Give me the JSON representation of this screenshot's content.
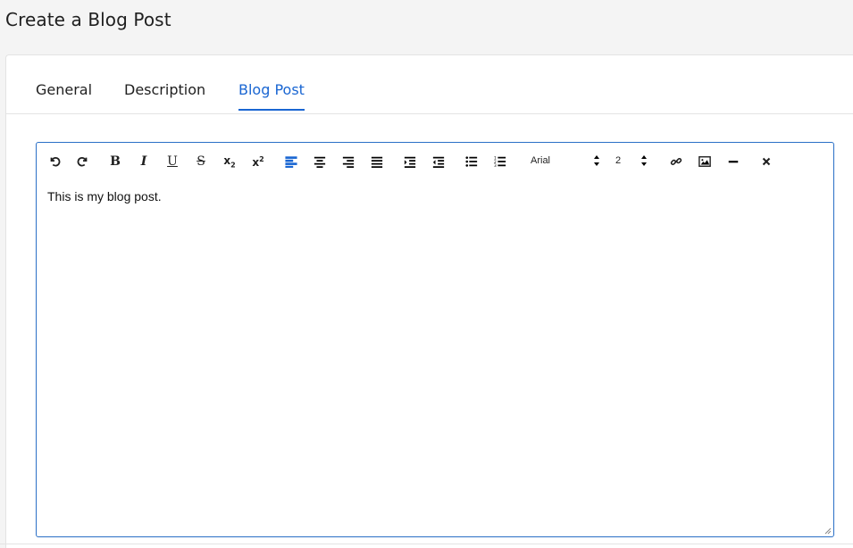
{
  "page": {
    "title": "Create a Blog Post"
  },
  "tabs": [
    {
      "label": "General",
      "active": false
    },
    {
      "label": "Description",
      "active": false
    },
    {
      "label": "Blog Post",
      "active": true
    }
  ],
  "editor": {
    "content": "This is my blog post.",
    "font": {
      "selected": "Arial"
    },
    "font_size": {
      "selected": "2"
    },
    "toolbar_icons": [
      "undo-icon",
      "redo-icon",
      "bold-icon",
      "italic-icon",
      "underline-icon",
      "strikethrough-icon",
      "subscript-icon",
      "superscript-icon",
      "align-left-icon",
      "align-center-icon",
      "align-right-icon",
      "align-justify-icon",
      "indent-icon",
      "outdent-icon",
      "bullet-list-icon",
      "numbered-list-icon",
      "link-icon",
      "image-icon",
      "horizontal-rule-icon",
      "clear-format-icon"
    ]
  },
  "colors": {
    "accent": "#1a66d2",
    "border": "#2a6fc6",
    "background": "#f4f4f4"
  }
}
